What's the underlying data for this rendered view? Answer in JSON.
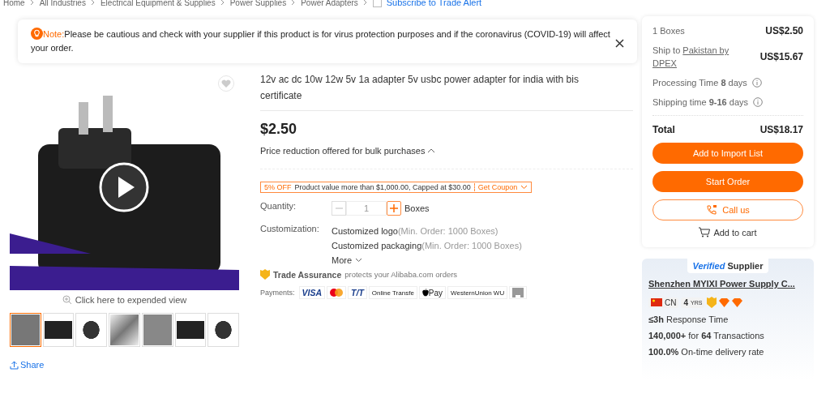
{
  "breadcrumb": {
    "items": [
      "Home",
      "All Industries",
      "Electrical Equipment & Supplies",
      "Power Supplies",
      "Power Adapters"
    ],
    "subscribe": "Subscribe to Trade Alert",
    "subscribed": false
  },
  "note": {
    "label": "Note:",
    "text": "Please be cautious and check with your supplier if this product is for virus protection purposes and if the coronavirus (COVID-19) will affect your order."
  },
  "gallery": {
    "expand": "Click here to expended view",
    "thumbnails": [
      {
        "selected": true
      },
      {
        "selected": false
      },
      {
        "selected": false
      },
      {
        "selected": false
      },
      {
        "selected": false
      },
      {
        "selected": false
      },
      {
        "selected": false
      }
    ],
    "share": "Share"
  },
  "product": {
    "title": "12v ac dc 10w 12w 5v 1a adapter 5v usbc power adapter for india with bis certificate",
    "price": "$2.50",
    "bulk": "Price reduction offered for bulk purchases",
    "coupon": {
      "discount": "5% OFF",
      "text": "Product value more than $1,000.00, Capped at $30.00",
      "action": "Get Coupon"
    },
    "quantity": {
      "label": "Quantity:",
      "value": "1",
      "unit": "Boxes"
    },
    "customization": {
      "label": "Customization:",
      "options": [
        {
          "name": "Customized logo",
          "min": "(Min. Order: 1000 Boxes)"
        },
        {
          "name": "Customized packaging",
          "min": "(Min. Order: 1000 Boxes)"
        }
      ],
      "more": "More"
    },
    "assurance": {
      "title": "Trade Assurance",
      "text": "protects your Alibaba.com orders"
    },
    "payments": {
      "label": "Payments:",
      "methods": [
        {
          "kind": "visa",
          "text": "VISA"
        },
        {
          "kind": "mastercard"
        },
        {
          "kind": "tt",
          "text": "T/T"
        },
        {
          "kind": "plain",
          "text": "Online Transfe"
        },
        {
          "kind": "applepay",
          "text": "Pay"
        },
        {
          "kind": "plain",
          "text": "WesternUnion WU"
        },
        {
          "kind": "barcode"
        }
      ]
    }
  },
  "summary": {
    "boxes": "1 Boxes",
    "boxes_price": "US$2.50",
    "ship_prefix": "Ship to",
    "ship_link": "Pakistan by DPEX",
    "ship_price": "US$15.67",
    "processing": "Processing Time **8** days",
    "shipping": "Shipping time **9-16** days",
    "total_label": "Total",
    "total": "US$18.17",
    "buttons": [
      "Add to Import List",
      "Start Order"
    ],
    "call": "Call us",
    "cart": "Add to cart"
  },
  "supplier": {
    "verified": "Verified",
    "badge": "Supplier",
    "name": "Shenzhen MYIXI Power Supply C...",
    "country": "CN",
    "years": "4",
    "years_unit": "YRS",
    "stats": [
      "**≤3h** Response Time",
      "**140,000+** for **64** Transactions",
      "**100.0%** On-time delivery rate"
    ]
  }
}
